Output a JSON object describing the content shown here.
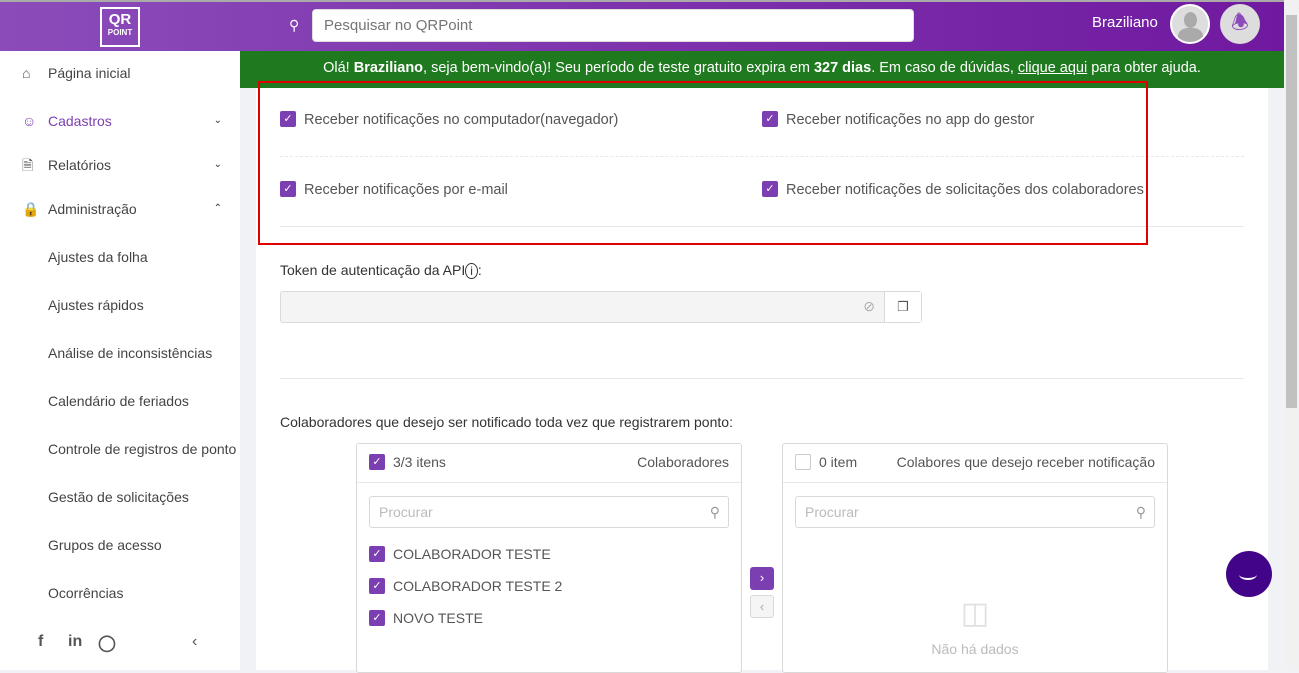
{
  "header": {
    "logo_top": "QR",
    "logo_bottom": "POINT",
    "search_placeholder": "Pesquisar no QRPoint",
    "user_name": "Braziliano"
  },
  "sidebar": {
    "items": [
      {
        "label": "Página inicial",
        "icon": "home-icon"
      },
      {
        "label": "Cadastros",
        "icon": "user-add-icon"
      },
      {
        "label": "Relatórios",
        "icon": "file-icon"
      },
      {
        "label": "Administração",
        "icon": "lock-icon"
      },
      {
        "label": "Ajustes da folha"
      },
      {
        "label": "Ajustes rápidos"
      },
      {
        "label": "Análise de inconsistências"
      },
      {
        "label": "Calendário de feriados"
      },
      {
        "label": "Controle de registros de ponto"
      },
      {
        "label": "Gestão de solicitações"
      },
      {
        "label": "Grupos de acesso"
      },
      {
        "label": "Ocorrências"
      }
    ]
  },
  "banner": {
    "p1": "Olá! ",
    "name": "Braziliano",
    "p2": ", seja bem-vindo(a)! Seu período de teste gratuito expira em ",
    "days": "327 dias",
    "p3": ". Em caso de dúvidas, ",
    "link": "clique aqui",
    "p4": " para obter ajuda."
  },
  "notifications": {
    "browser": "Receber notificações no computador(navegador)",
    "app": "Receber notificações no app do gestor",
    "email": "Receber notificações por e-mail",
    "requests": "Receber notificações de solicitações dos colaboradores"
  },
  "token": {
    "label": "Token de autenticação da API",
    "colon": ":"
  },
  "collaborators": {
    "label": "Colaboradores que desejo ser notificado toda vez que registrarem ponto",
    "colon": ":",
    "left": {
      "count": "3/3 itens",
      "title": "Colaboradores",
      "search_placeholder": "Procurar",
      "items": [
        "COLABORADOR TESTE",
        "COLABORADOR TESTE 2",
        "NOVO TESTE"
      ]
    },
    "right": {
      "count": "0 item",
      "title": "Colabores que desejo receber notificação",
      "search_placeholder": "Procurar",
      "empty": "Não há dados"
    }
  },
  "colors": {
    "primary": "#7b3fb1",
    "banner": "#1f7a1f",
    "chat": "#42058a"
  }
}
